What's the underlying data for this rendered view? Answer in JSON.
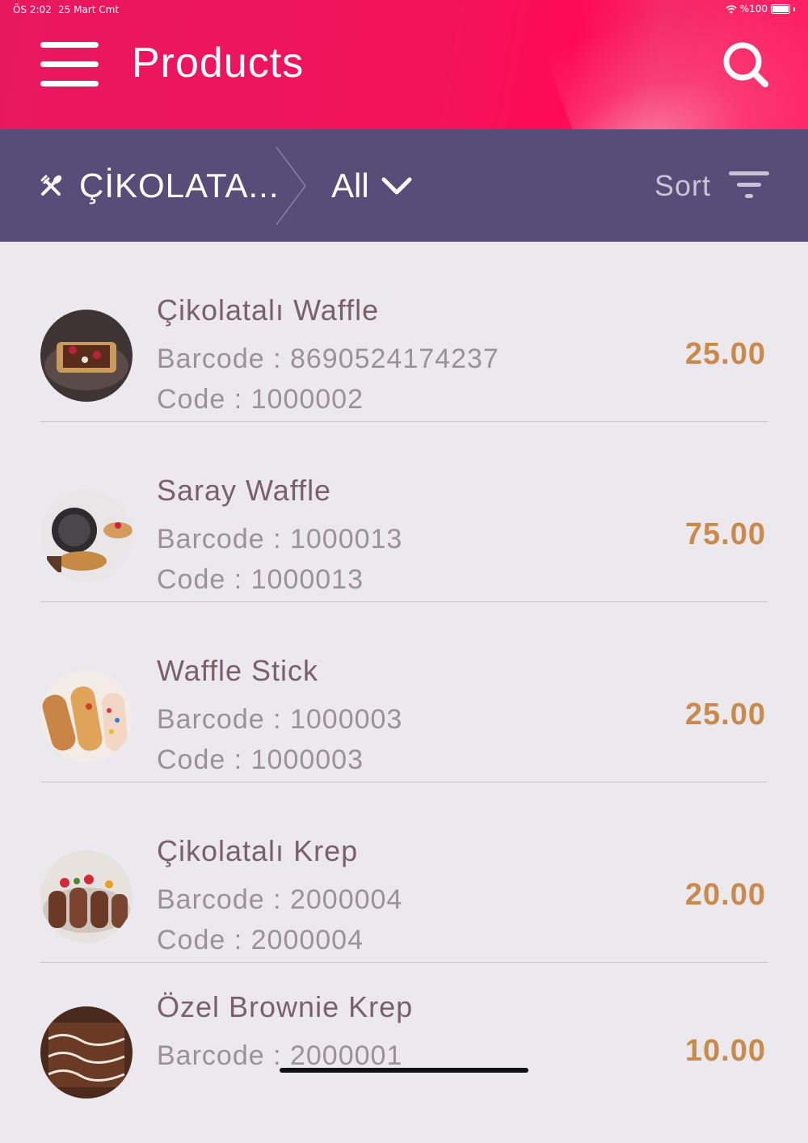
{
  "status": {
    "time": "ÖS 2:02",
    "date": "25 Mart Cmt",
    "battery": "%100"
  },
  "header": {
    "title": "Products",
    "menu_icon": "hamburger-menu-icon",
    "search_icon": "search-icon"
  },
  "filter": {
    "category_icon": "fork-spoon-icon",
    "category": "ÇİKOLATA...",
    "subfilter": "All",
    "sort_label": "Sort",
    "sort_icon": "sort-lines-icon"
  },
  "colors": {
    "header": "#f2125c",
    "filterbar": "#584c78",
    "price": "#c98a4b",
    "background": "#ebe8ee"
  },
  "products": [
    {
      "name": "Çikolatalı Waffle",
      "barcode": "Barcode : 8690524174237",
      "code": "Code : 1000002",
      "price": "25.00"
    },
    {
      "name": "Saray Waffle",
      "barcode": "Barcode : 1000013",
      "code": "Code : 1000013",
      "price": "75.00"
    },
    {
      "name": "Waffle Stick",
      "barcode": "Barcode : 1000003",
      "code": "Code : 1000003",
      "price": "25.00"
    },
    {
      "name": "Çikolatalı Krep",
      "barcode": "Barcode : 2000004",
      "code": "Code : 2000004",
      "price": "20.00"
    },
    {
      "name": "Özel Brownie Krep",
      "barcode": "Barcode : 2000001",
      "code": "",
      "price": "10.00"
    }
  ]
}
